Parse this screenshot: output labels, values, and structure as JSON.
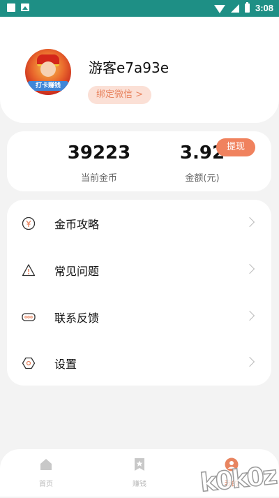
{
  "status_bar": {
    "time": "3:08"
  },
  "profile": {
    "username": "游客e7a93e",
    "bind_wechat_label": "绑定微信 >",
    "avatar_banner_text": "打卡赚钱"
  },
  "stats": {
    "coins_value": "39223",
    "coins_label": "当前金币",
    "amount_value": "3.92",
    "amount_label": "金额(元)",
    "withdraw_label": "提现"
  },
  "menu": {
    "items": [
      {
        "label": "金币攻略",
        "icon": "yuan-coin-icon"
      },
      {
        "label": "常见问题",
        "icon": "warning-triangle-icon"
      },
      {
        "label": "联系反馈",
        "icon": "chat-bubble-icon"
      },
      {
        "label": "设置",
        "icon": "hexagon-settings-icon"
      }
    ]
  },
  "bottom_nav": {
    "items": [
      {
        "label": "首页",
        "icon": "home-icon"
      },
      {
        "label": "赚钱",
        "icon": "star-bookmark-icon"
      },
      {
        "label": "我的",
        "icon": "profile-icon"
      }
    ],
    "active_color": "#e8845f",
    "inactive_color": "#bbbbbb"
  },
  "watermark": "k0k0z",
  "colors": {
    "status_bar": "#1e8f85",
    "accent": "#f0825e",
    "bind_bg": "#fbe0d6",
    "background": "#f3f3f3"
  }
}
